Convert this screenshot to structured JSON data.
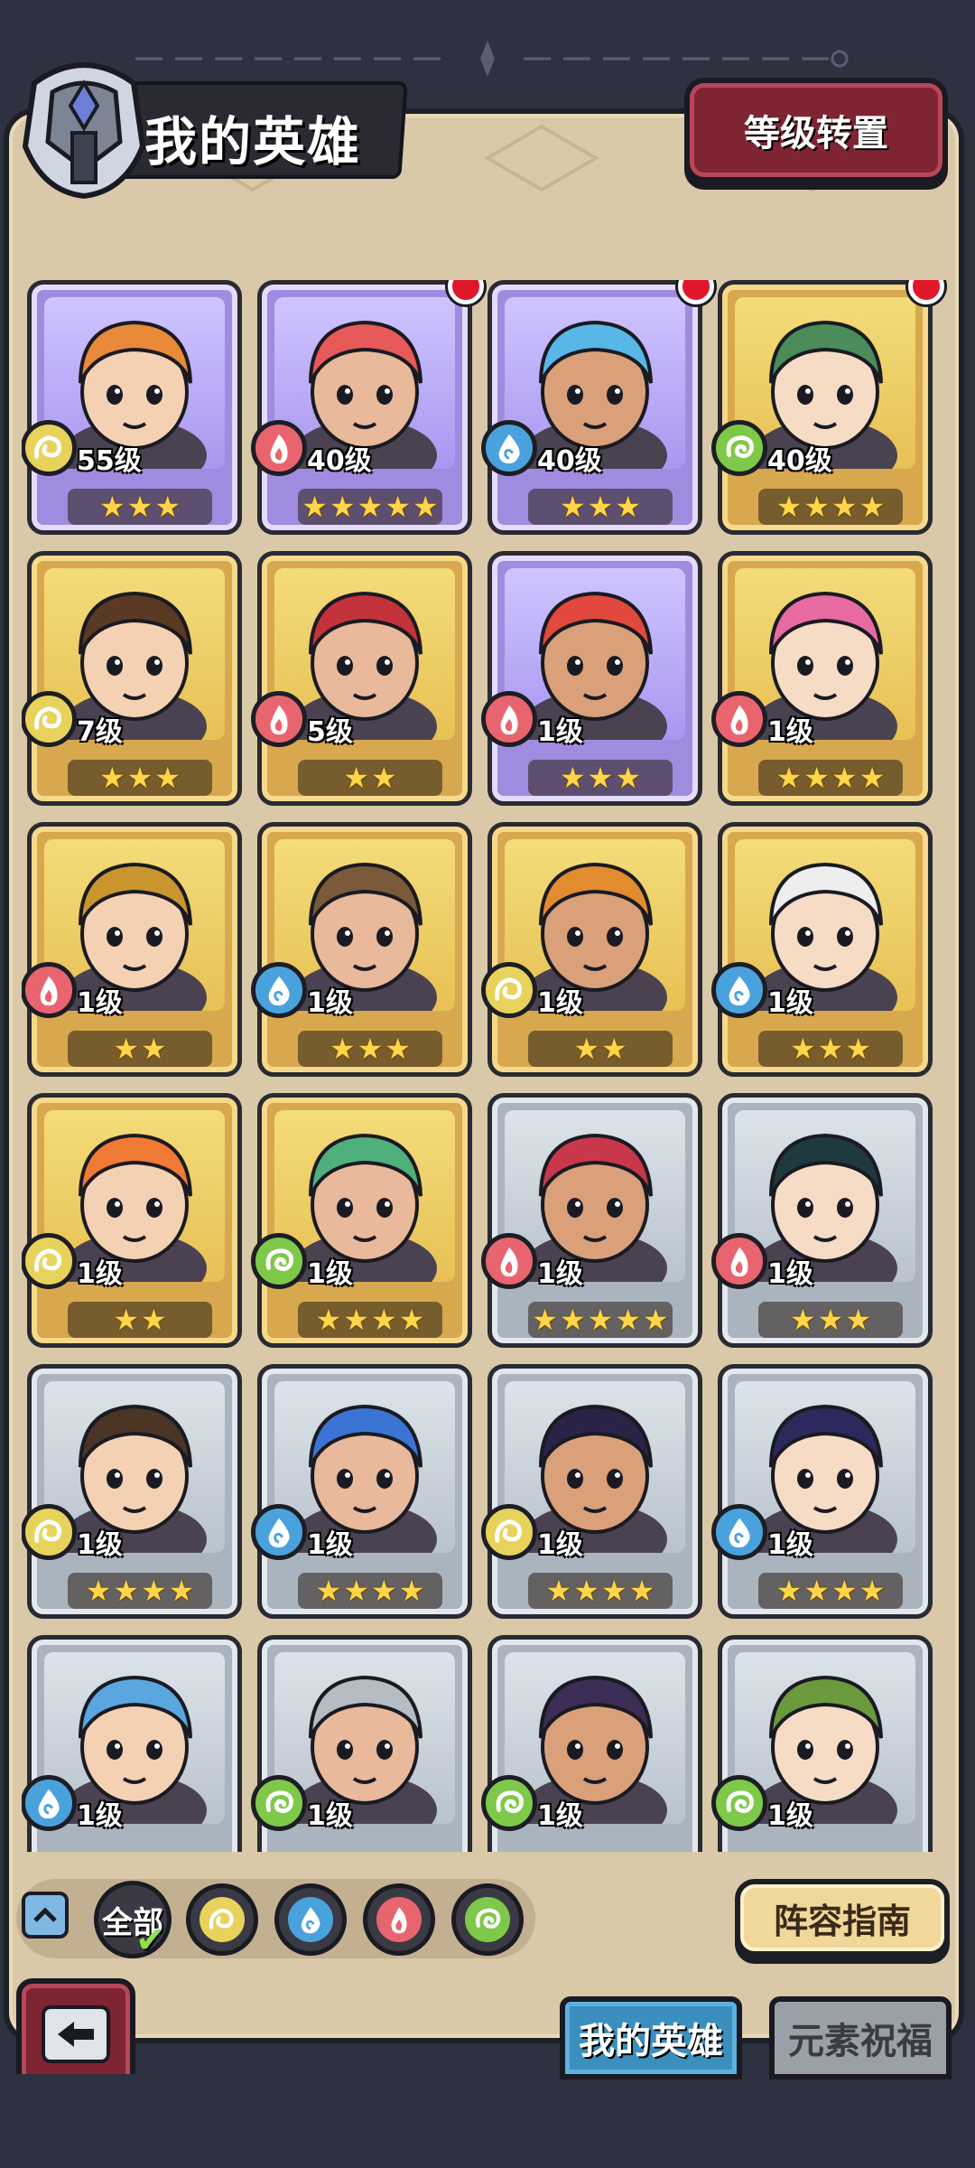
{
  "header": {
    "title": "我的英雄",
    "level_reset_label": "等级转置"
  },
  "colors": {
    "earth": "#e7d35b",
    "water": "#4aa2dd",
    "fire": "#e8656f",
    "wind": "#7ec84a",
    "gold_frame": "#d8a84e",
    "purple_frame": "#9f8ce0",
    "silver_frame": "#aab4bf"
  },
  "heroes": [
    {
      "level": "55级",
      "element": "earth",
      "stars": 3,
      "frame": "purple",
      "alert": false,
      "portrait": "tiger-warrior",
      "hair": "#e88a3a"
    },
    {
      "level": "40级",
      "element": "fire",
      "stars": 5,
      "frame": "purple",
      "alert": true,
      "portrait": "rose-maiden",
      "hair": "#e8595a"
    },
    {
      "level": "40级",
      "element": "water",
      "stars": 3,
      "frame": "purple",
      "alert": true,
      "portrait": "elf-sorceress",
      "hair": "#58b7e6"
    },
    {
      "level": "40级",
      "element": "wind",
      "stars": 4,
      "frame": "gold",
      "alert": true,
      "portrait": "tattooed-fighter",
      "hair": "#4b8c5a"
    },
    {
      "level": "7级",
      "element": "earth",
      "stars": 3,
      "frame": "gold",
      "alert": false,
      "portrait": "braided-warrior",
      "hair": "#5a3a22"
    },
    {
      "level": "5级",
      "element": "fire",
      "stars": 2,
      "frame": "gold",
      "alert": false,
      "portrait": "redhead-scholar",
      "hair": "#c4323b"
    },
    {
      "level": "1级",
      "element": "fire",
      "stars": 3,
      "frame": "purple",
      "alert": false,
      "portrait": "masked-dancer",
      "hair": "#e2483e"
    },
    {
      "level": "1级",
      "element": "fire",
      "stars": 4,
      "frame": "gold",
      "alert": false,
      "portrait": "pink-engineer",
      "hair": "#e76aa0"
    },
    {
      "level": "1级",
      "element": "fire",
      "stars": 2,
      "frame": "gold",
      "alert": false,
      "portrait": "golden-knight",
      "hair": "#c9952f"
    },
    {
      "level": "1级",
      "element": "water",
      "stars": 3,
      "frame": "gold",
      "alert": false,
      "portrait": "wooden-mask",
      "hair": "#7a5a3b"
    },
    {
      "level": "1级",
      "element": "earth",
      "stars": 2,
      "frame": "gold",
      "alert": false,
      "portrait": "lion-beard",
      "hair": "#e28b2f"
    },
    {
      "level": "1级",
      "element": "water",
      "stars": 3,
      "frame": "gold",
      "alert": false,
      "portrait": "white-hair-goggles",
      "hair": "#eeeeee"
    },
    {
      "level": "1级",
      "element": "earth",
      "stars": 2,
      "frame": "gold",
      "alert": false,
      "portrait": "orange-bun-girl",
      "hair": "#f07a34"
    },
    {
      "level": "1级",
      "element": "wind",
      "stars": 4,
      "frame": "gold",
      "alert": false,
      "portrait": "green-elf",
      "hair": "#4fb07b"
    },
    {
      "level": "1级",
      "element": "fire",
      "stars": 5,
      "frame": "silver",
      "alert": false,
      "portrait": "crimson-elf",
      "hair": "#c8374a"
    },
    {
      "level": "1级",
      "element": "fire",
      "stars": 3,
      "frame": "silver",
      "alert": false,
      "portrait": "dark-swordsman",
      "hair": "#1f3a3e"
    },
    {
      "level": "1级",
      "element": "earth",
      "stars": 4,
      "frame": "silver",
      "alert": false,
      "portrait": "bearded-brawler",
      "hair": "#4a3526"
    },
    {
      "level": "1级",
      "element": "water",
      "stars": 4,
      "frame": "silver",
      "alert": false,
      "portrait": "blue-twin-tails",
      "hair": "#3c74d6"
    },
    {
      "level": "1级",
      "element": "earth",
      "stars": 4,
      "frame": "silver",
      "alert": false,
      "portrait": "dark-sorceress",
      "hair": "#2b2347"
    },
    {
      "level": "1级",
      "element": "water",
      "stars": 4,
      "frame": "silver",
      "alert": false,
      "portrait": "violet-assassin",
      "hair": "#2c2a5c"
    },
    {
      "level": "1级",
      "element": "water",
      "stars": 0,
      "frame": "silver",
      "alert": false,
      "portrait": "blue-dragon",
      "hair": "#5aa7e0"
    },
    {
      "level": "1级",
      "element": "wind",
      "stars": 0,
      "frame": "silver",
      "alert": false,
      "portrait": "armored-knight",
      "hair": "#b6bcc4"
    },
    {
      "level": "1级",
      "element": "wind",
      "stars": 0,
      "frame": "silver",
      "alert": false,
      "portrait": "horned-beast",
      "hair": "#3b2d54"
    },
    {
      "level": "1级",
      "element": "wind",
      "stars": 0,
      "frame": "silver",
      "alert": false,
      "portrait": "tree-spirit",
      "hair": "#6b9a3c"
    }
  ],
  "filters": {
    "all_label": "全部",
    "elements": [
      "earth",
      "water",
      "fire",
      "wind"
    ]
  },
  "guide_label": "阵容指南",
  "tabs": [
    {
      "label": "我的英雄",
      "active": true
    },
    {
      "label": "元素祝福",
      "active": false
    }
  ]
}
